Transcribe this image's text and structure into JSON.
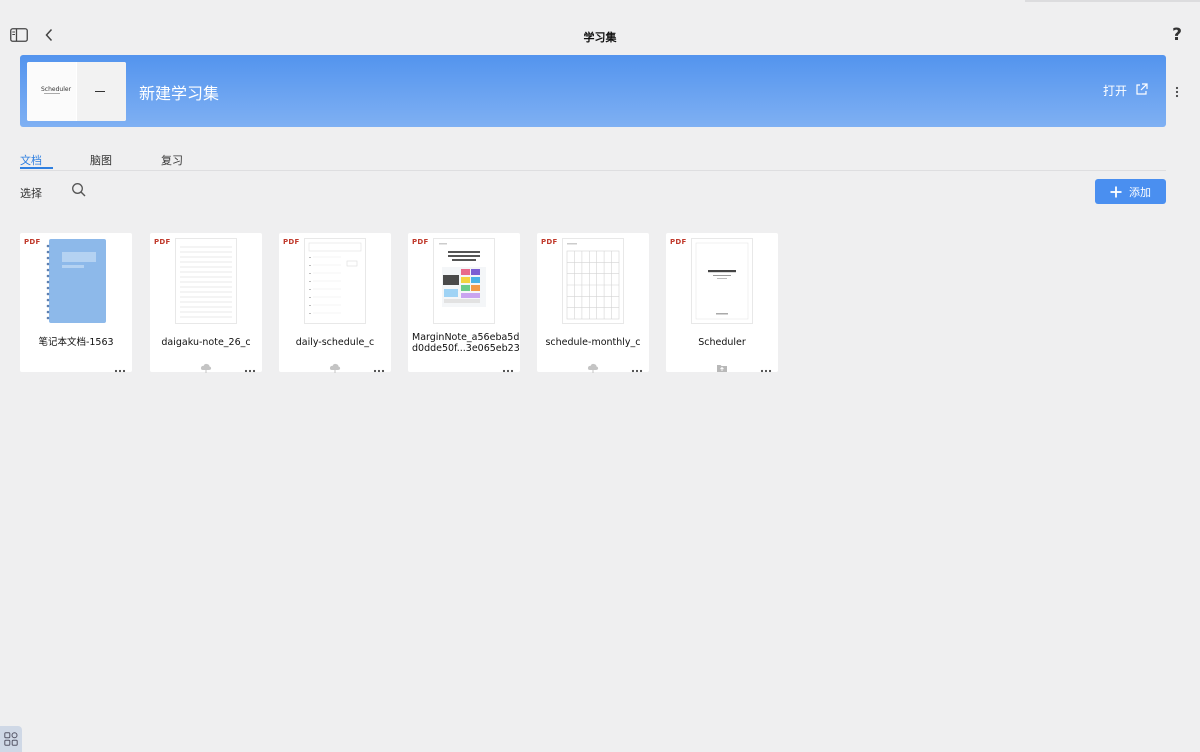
{
  "header": {
    "title": "学习集",
    "help_label": "?"
  },
  "banner": {
    "title": "新建学习集",
    "open_label": "打开",
    "thumb_text": "Scheduler",
    "color_top": "#5394ee",
    "color_bottom": "#7fb0f3"
  },
  "tabs": [
    {
      "label": "文档",
      "active": true
    },
    {
      "label": "脑图",
      "active": false
    },
    {
      "label": "复习",
      "active": false
    }
  ],
  "toolbar": {
    "select_label": "选择",
    "add_label": "添加"
  },
  "documents": [
    {
      "type": "PDF",
      "name": "笔记本文档-1563",
      "thumb": "notebook",
      "status_icon": "none"
    },
    {
      "type": "PDF",
      "name": "daigaku-note_26_c",
      "thumb": "lined",
      "status_icon": "cloud-icon"
    },
    {
      "type": "PDF",
      "name": "daily-schedule_c",
      "thumb": "schedule",
      "status_icon": "cloud-icon"
    },
    {
      "type": "PDF",
      "name": "MarginNote_a56eba5d d0dde50f...3e065eb23",
      "thumb": "marginnote",
      "status_icon": "none"
    },
    {
      "type": "PDF",
      "name": "schedule-monthly_c",
      "thumb": "grid",
      "status_icon": "cloud-icon"
    },
    {
      "type": "PDF",
      "name": "Scheduler",
      "thumb": "scheduler",
      "status_icon": "folder-icon"
    }
  ],
  "colors": {
    "accent": "#2f7fe0",
    "add_button": "#4a8ff0",
    "pdf_tag": "#c0392b",
    "background": "#efeff0"
  }
}
